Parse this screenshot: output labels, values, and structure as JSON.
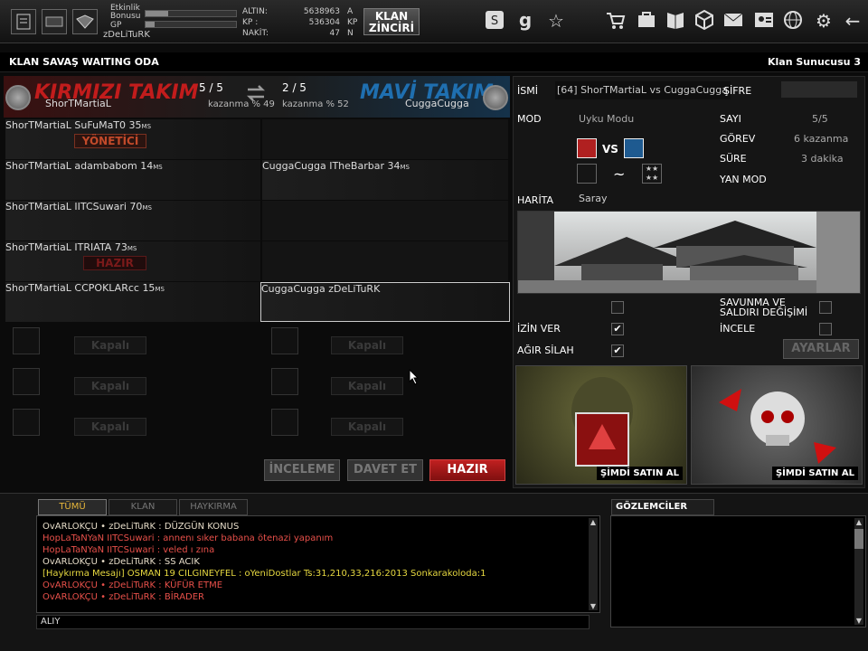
{
  "topbar": {
    "etkinlik_label": "Etkinlik",
    "bonusu_label": "Bonusu",
    "gp_label": "GP",
    "username": "zDeLiTuRK",
    "etkinlik_progress": 0.25,
    "gp_progress": 0.1,
    "altin_label": "ALTIN:",
    "altin_value": "5638963",
    "altin_unit": "A",
    "kp_label": "KP :",
    "kp_value": "536304",
    "kp_unit": "KP",
    "nakit_label": "NAKİT:",
    "nakit_value": "47",
    "nakit_unit": "N",
    "klan_zinciri": [
      "KLAN",
      "ZİNCİRİ"
    ],
    "icons": [
      "skype-icon",
      "g-icon",
      "star-icon",
      "cart-icon",
      "inventory-icon",
      "book-icon",
      "box-icon",
      "mail-icon",
      "contacts-icon",
      "web-icon",
      "gear-icon",
      "back-arrow-icon"
    ]
  },
  "title": {
    "room": "KLAN SAVAŞ WAITING ODA",
    "server": "Klan Sunucusu 3"
  },
  "teams": {
    "red_title": "KIRMIZI TAKIM",
    "red_leader": "ShorTMartiaL",
    "red_count": "5 / 5",
    "red_win": "kazanma % 49",
    "blue_title": "MAVİ TAKIM",
    "blue_leader": "CuggaCugga",
    "blue_count": "2 / 5",
    "blue_win": "kazanma % 52"
  },
  "red_players": [
    {
      "clan": "ShorTMartiaL",
      "name": "SuFuMaT0",
      "ping": "35",
      "badge": "YÖNETİCİ"
    },
    {
      "clan": "ShorTMartiaL",
      "name": "adambabom",
      "ping": "14",
      "badge": ""
    },
    {
      "clan": "ShorTMartiaL",
      "name": "IITCSuwari",
      "ping": "70",
      "badge": ""
    },
    {
      "clan": "ShorTMartiaL",
      "name": "ITRIATA",
      "ping": "73",
      "badge": "HAZIR"
    },
    {
      "clan": "ShorTMartiaL",
      "name": "CCPOKLARcc",
      "ping": "15",
      "badge": ""
    }
  ],
  "blue_players": [
    {
      "clan": "CuggaCugga",
      "name": "ITheBarbar",
      "ping": "34"
    },
    {
      "clan": "CuggaCugga",
      "name": "zDeLiTuRK",
      "ping": ""
    }
  ],
  "ms_unit": "MS",
  "kapali_label": "Kapalı",
  "actions": {
    "inceleme": "İNCELEME",
    "davet": "DAVET ET",
    "hazir": "HAZIR"
  },
  "room_info": {
    "isim_label": "İSMİ",
    "isim_value": "[64] ShorTMartiaL vs CuggaCugga",
    "sifre_label": "ŞİFRE",
    "mod_label": "MOD",
    "mod_value": "Uyku Modu",
    "vs": "VS",
    "tilde": "~",
    "sayi_label": "SAYI",
    "sayi_value": "5/5",
    "gorev_label": "GÖREV",
    "gorev_value": "6 kazanma",
    "sure_label": "SÜRE",
    "sure_value": "3 dakika",
    "yan_mod_label": "YAN MOD",
    "harita_label": "HARİTA",
    "harita_value": "Saray",
    "savunma_label": [
      "SAVUNMA VE",
      "SALDIRI DEĞİŞİMİ"
    ],
    "izin_label": "İZİN VER",
    "incele_label": "İNCELE",
    "agir_label": "AĞIR SİLAH",
    "ayarlar": "AYARLAR",
    "shop_label": "ŞİMDİ SATIN AL"
  },
  "chat": {
    "tabs": [
      "TÜMÜ",
      "KLAN",
      "HAYKIRMA"
    ],
    "observers": "GÖZLEMCİLER",
    "input": "ALIY",
    "lines": [
      {
        "text": "OvARLOKÇU • zDeLiTuRK : DÜZGÜN KONUS",
        "color": "#e6dcc8"
      },
      {
        "text": "HopLaTaNYaN IITCSuwari : annenı sıker babana ötenazi yapanım",
        "color": "#e8504a"
      },
      {
        "text": "HopLaTaNYaN IITCSuwari : veled ı zına",
        "color": "#e8504a"
      },
      {
        "text": "OvARLOKÇU • zDeLiTuRK : SS ACIK",
        "color": "#e6dcc8"
      },
      {
        "text": "[Haykırma Mesajı]  OSMAN 19  CILGINEYFEL  : oYeniDostlar Ts:31,210,33,216:2013 Sonkarakoloda:1",
        "color": "#e6d840"
      },
      {
        "text": "OvARLOKÇU • zDeLiTuRK : KÜFÜR ETME",
        "color": "#e8504a"
      },
      {
        "text": "OvARLOKÇU • zDeLiTuRK : BİRADER",
        "color": "#e8504a"
      }
    ]
  }
}
